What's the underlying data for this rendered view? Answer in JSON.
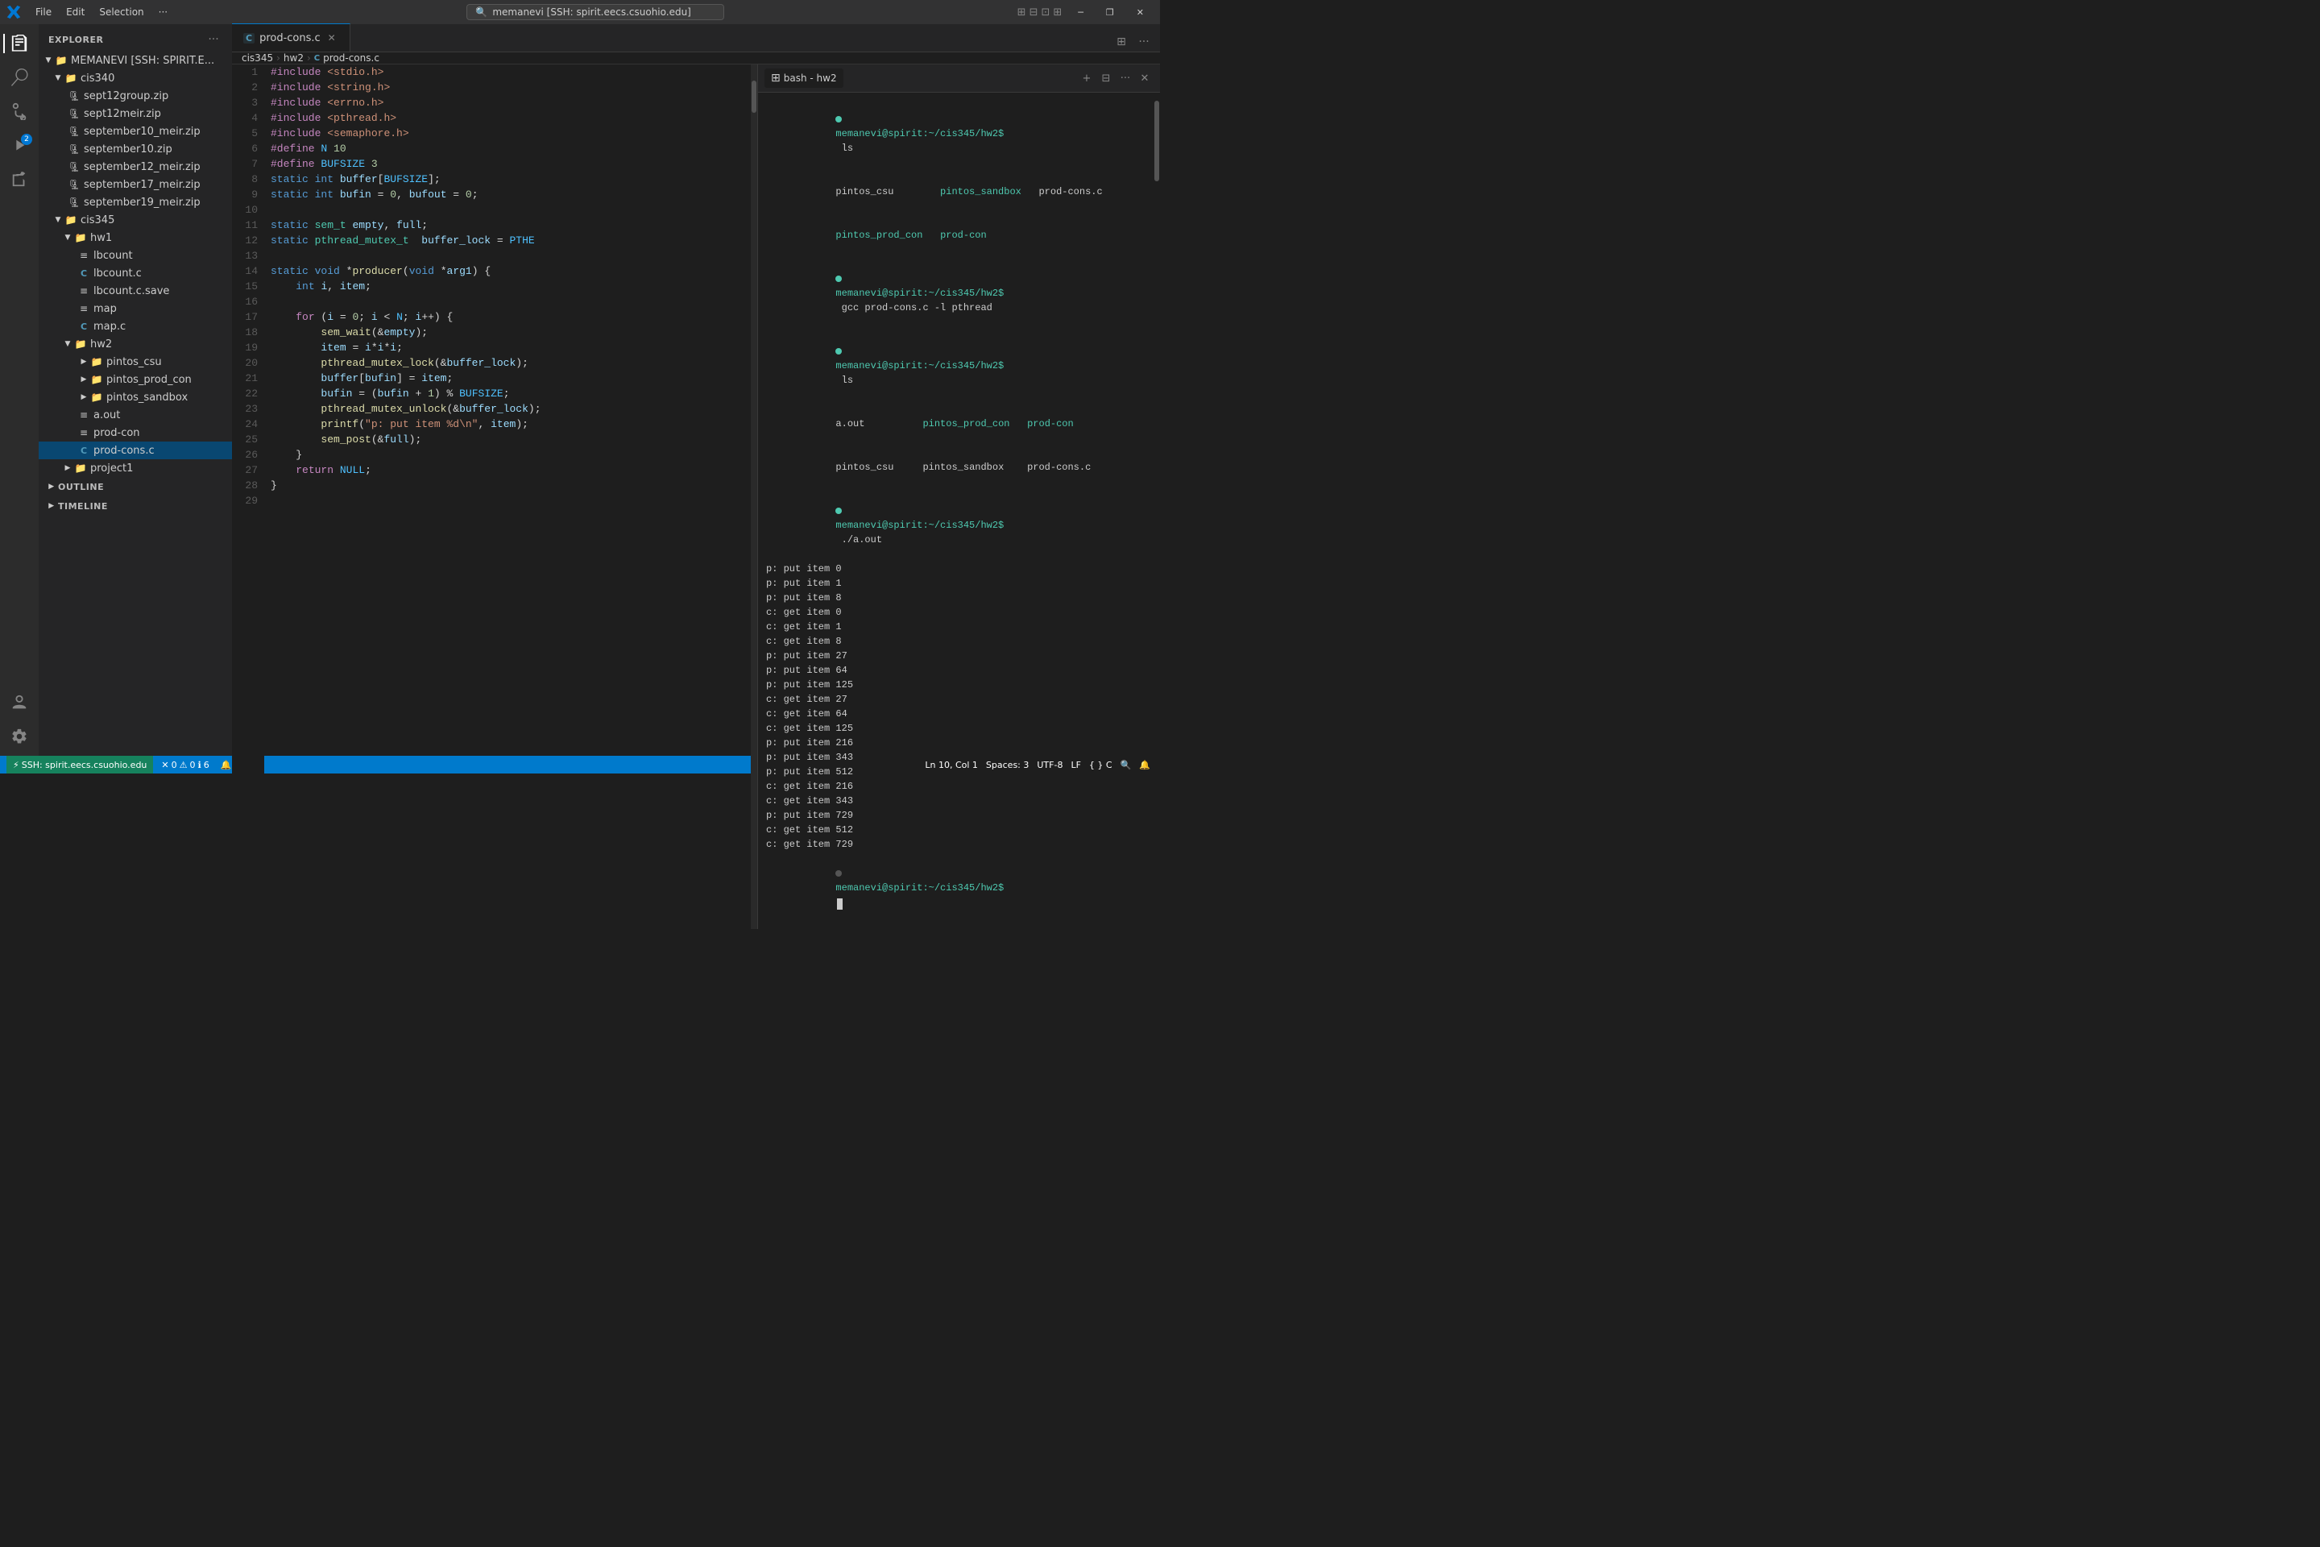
{
  "titleBar": {
    "menuItems": [
      "File",
      "Edit",
      "Selection",
      "···"
    ],
    "search": "memanevi [SSH: spirit.eecs.csuohio.edu]",
    "windowControls": [
      "─",
      "❐",
      "✕"
    ]
  },
  "sidebar": {
    "title": "EXPLORER",
    "rootLabel": "MEMANEVI [SSH: SPIRIT.E...",
    "tree": [
      {
        "id": "cis340",
        "label": "cis340",
        "type": "folder",
        "level": 1,
        "expanded": true
      },
      {
        "id": "sept12group",
        "label": "sept12group.zip",
        "type": "zip",
        "level": 2
      },
      {
        "id": "sept12meir",
        "label": "sept12meir.zip",
        "type": "zip",
        "level": 2
      },
      {
        "id": "september10_meir",
        "label": "september10_meir.zip",
        "type": "zip",
        "level": 2
      },
      {
        "id": "september10",
        "label": "september10.zip",
        "type": "zip",
        "level": 2
      },
      {
        "id": "september12_meir",
        "label": "september12_meir.zip",
        "type": "zip",
        "level": 2
      },
      {
        "id": "september17_meir",
        "label": "september17_meir.zip",
        "type": "zip",
        "level": 2
      },
      {
        "id": "september19_meir",
        "label": "september19_meir.zip",
        "type": "zip",
        "level": 2
      },
      {
        "id": "cis345",
        "label": "cis345",
        "type": "folder",
        "level": 1,
        "expanded": true
      },
      {
        "id": "hw1",
        "label": "hw1",
        "type": "folder",
        "level": 2,
        "expanded": true
      },
      {
        "id": "lbcount",
        "label": "lbcount",
        "type": "file",
        "level": 3
      },
      {
        "id": "lbcount_c",
        "label": "lbcount.c",
        "type": "c",
        "level": 3
      },
      {
        "id": "lbcount_save",
        "label": "lbcount.c.save",
        "type": "file",
        "level": 3
      },
      {
        "id": "map",
        "label": "map",
        "type": "file",
        "level": 3
      },
      {
        "id": "map_c",
        "label": "map.c",
        "type": "c",
        "level": 3
      },
      {
        "id": "hw2",
        "label": "hw2",
        "type": "folder",
        "level": 2,
        "expanded": true
      },
      {
        "id": "pintos_csu",
        "label": "pintos_csu",
        "type": "folder",
        "level": 3,
        "expanded": false
      },
      {
        "id": "pintos_prod_con",
        "label": "pintos_prod_con",
        "type": "folder",
        "level": 3,
        "expanded": false
      },
      {
        "id": "pintos_sandbox",
        "label": "pintos_sandbox",
        "type": "folder",
        "level": 3,
        "expanded": false
      },
      {
        "id": "a_out",
        "label": "a.out",
        "type": "file",
        "level": 3
      },
      {
        "id": "prod_con",
        "label": "prod-con",
        "type": "file",
        "level": 3
      },
      {
        "id": "prod_cons_c",
        "label": "prod-cons.c",
        "type": "c",
        "level": 3,
        "active": true
      },
      {
        "id": "project1",
        "label": "project1",
        "type": "folder",
        "level": 2,
        "expanded": false
      }
    ],
    "sections": [
      {
        "id": "outline",
        "label": "OUTLINE"
      },
      {
        "id": "timeline",
        "label": "TIMELINE"
      }
    ]
  },
  "editor": {
    "tab": {
      "icon": "C",
      "label": "prod-cons.c",
      "modified": false
    },
    "breadcrumb": [
      "cis345",
      "hw2",
      "prod-cons.c"
    ],
    "lines": [
      {
        "n": 1,
        "code": "#include <stdio.h>"
      },
      {
        "n": 2,
        "code": "#include <string.h>"
      },
      {
        "n": 3,
        "code": "#include <errno.h>"
      },
      {
        "n": 4,
        "code": "#include <pthread.h>"
      },
      {
        "n": 5,
        "code": "#include <semaphore.h>"
      },
      {
        "n": 6,
        "code": "#define N 10"
      },
      {
        "n": 7,
        "code": "#define BUFSIZE 3"
      },
      {
        "n": 8,
        "code": "static int buffer[BUFSIZE];"
      },
      {
        "n": 9,
        "code": "static int bufin = 0, bufout = 0;"
      },
      {
        "n": 10,
        "code": ""
      },
      {
        "n": 11,
        "code": "static sem_t empty, full;"
      },
      {
        "n": 12,
        "code": "static pthread_mutex_t  buffer_lock = PTHE"
      },
      {
        "n": 13,
        "code": ""
      },
      {
        "n": 14,
        "code": "static void *producer(void *arg1) {"
      },
      {
        "n": 15,
        "code": "    int i, item;"
      },
      {
        "n": 16,
        "code": ""
      },
      {
        "n": 17,
        "code": "    for (i = 0; i < N; i++) {"
      },
      {
        "n": 18,
        "code": "        sem_wait(&empty);"
      },
      {
        "n": 19,
        "code": "        item = i*i*i;"
      },
      {
        "n": 20,
        "code": "        pthread_mutex_lock(&buffer_lock);"
      },
      {
        "n": 21,
        "code": "        buffer[bufin] = item;"
      },
      {
        "n": 22,
        "code": "        bufin = (bufin + 1) % BUFSIZE;"
      },
      {
        "n": 23,
        "code": "        pthread_mutex_unlock(&buffer_lock);"
      },
      {
        "n": 24,
        "code": "        printf(\"p: put item %d\\n\", item);"
      },
      {
        "n": 25,
        "code": "        sem_post(&full);"
      },
      {
        "n": 26,
        "code": "    }"
      },
      {
        "n": 27,
        "code": "    return NULL;"
      },
      {
        "n": 28,
        "code": "}"
      },
      {
        "n": 29,
        "code": ""
      }
    ]
  },
  "terminal": {
    "tabLabel": "bash - hw2",
    "lines": [
      {
        "type": "prompt",
        "text": "memanevi@spirit:~/cis345/hw2$ ls"
      },
      {
        "type": "output",
        "text": "pintos_csu        pintos_sandbox   prod-cons.c"
      },
      {
        "type": "output",
        "text": "pintos_prod_con   prod-con"
      },
      {
        "type": "prompt",
        "text": "memanevi@spirit:~/cis345/hw2$ gcc prod-cons.c -l pthread"
      },
      {
        "type": "prompt",
        "text": "memanevi@spirit:~/cis345/hw2$ ls"
      },
      {
        "type": "output",
        "text": "a.out          pintos_prod_con   prod-con"
      },
      {
        "type": "output",
        "text": "pintos_csu     pintos_sandbox    prod-cons.c"
      },
      {
        "type": "prompt",
        "text": "memanevi@spirit:~/cis345/hw2$ ./a.out"
      },
      {
        "type": "output",
        "text": "p: put item 0"
      },
      {
        "type": "output",
        "text": "p: put item 1"
      },
      {
        "type": "output",
        "text": "p: put item 8"
      },
      {
        "type": "output",
        "text": "c: get item 0"
      },
      {
        "type": "output",
        "text": "c: get item 1"
      },
      {
        "type": "output",
        "text": "c: get item 8"
      },
      {
        "type": "output",
        "text": "p: put item 27"
      },
      {
        "type": "output",
        "text": "p: put item 64"
      },
      {
        "type": "output",
        "text": "p: put item 125"
      },
      {
        "type": "output",
        "text": "c: get item 27"
      },
      {
        "type": "output",
        "text": "c: get item 64"
      },
      {
        "type": "output",
        "text": "c: get item 125"
      },
      {
        "type": "output",
        "text": "p: put item 216"
      },
      {
        "type": "output",
        "text": "p: put item 343"
      },
      {
        "type": "output",
        "text": "p: put item 512"
      },
      {
        "type": "output",
        "text": "c: get item 216"
      },
      {
        "type": "output",
        "text": "c: get item 343"
      },
      {
        "type": "output",
        "text": "p: put item 729"
      },
      {
        "type": "output",
        "text": "c: get item 512"
      },
      {
        "type": "output",
        "text": "c: get item 729"
      },
      {
        "type": "prompt-cursor",
        "text": "memanevi@spirit:~/cis345/hw2$ "
      }
    ]
  },
  "statusBar": {
    "remote": "SSH: spirit.eecs.csuohio.edu",
    "errors": "0",
    "warnings": "0",
    "info": "6",
    "notifications": "0",
    "position": "Ln 10, Col 1",
    "spaces": "Spaces: 3",
    "encoding": "UTF-8",
    "eol": "LF",
    "language": "{ } C"
  }
}
